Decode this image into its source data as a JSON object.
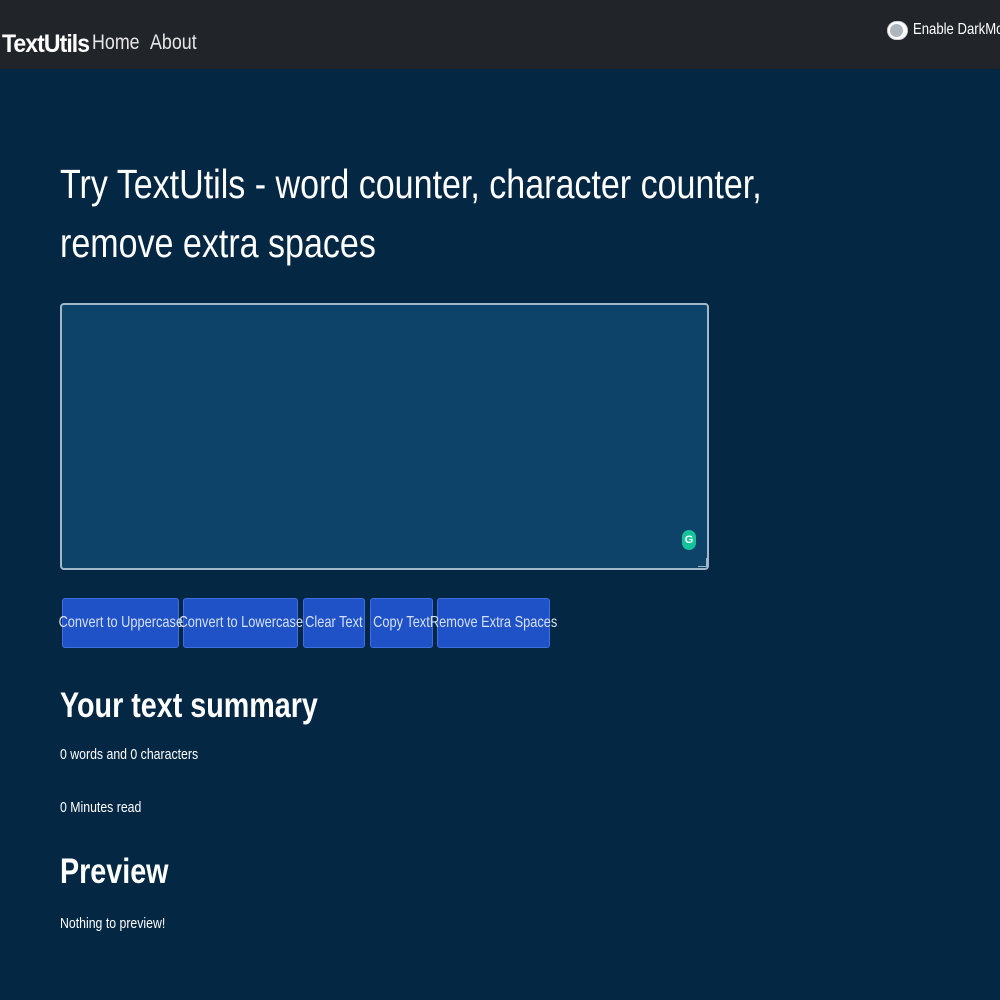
{
  "navbar": {
    "brand": "TextUtils",
    "links": [
      "Home",
      "About"
    ],
    "dark_mode_label": "Enable DarkMode"
  },
  "main": {
    "heading": "Try TextUtils - word counter, character counter, remove extra spaces",
    "textarea_value": "",
    "buttons": [
      "Convert to Uppercase",
      "Convert to Lowercase",
      "Clear Text",
      "Copy Text",
      "Remove Extra Spaces"
    ],
    "summary_title": "Your text summary",
    "word_char_count": "0 words and 0 characters",
    "minutes_read": "0 Minutes read",
    "preview_title": "Preview",
    "preview_text": "Nothing to preview!"
  },
  "icons": {
    "grammarly": "grammarly-icon",
    "toggle": "toggle-switch-icon"
  },
  "colors": {
    "background": "#042743",
    "navbar": "#212529",
    "textarea": "#0d4269",
    "button": "#1f52c6",
    "grammarly": "#15c39a"
  }
}
